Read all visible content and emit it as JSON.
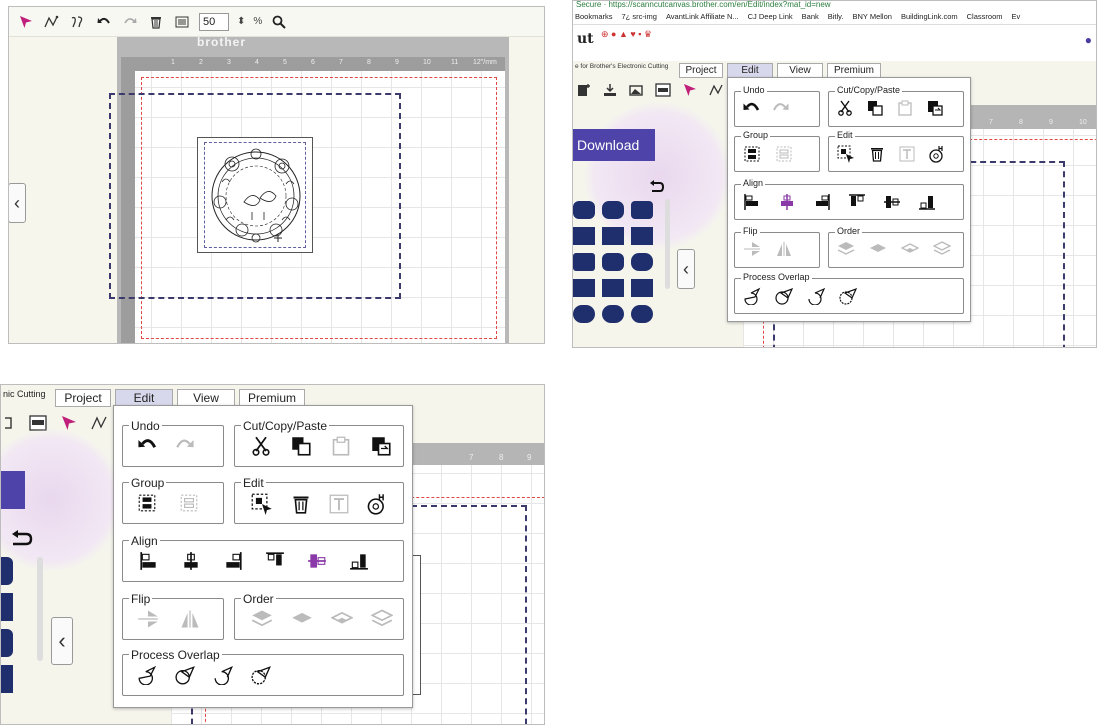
{
  "panel1": {
    "zoom_value": "50",
    "zoom_unit": "%",
    "mat_brand": "brother",
    "ruler_ticks": [
      "1",
      "2",
      "3",
      "4",
      "5",
      "6",
      "7",
      "8",
      "9",
      "10",
      "11",
      "12\"/mm"
    ]
  },
  "panel2": {
    "url": "Secure · https://scanncutcanvas.brother.com/en/Edit/index?mat_id=new",
    "bookmarks": [
      "Bookmarks",
      "7¿ src-img",
      "AvantLink Affiliate N...",
      "CJ Deep Link",
      "Bank",
      "Bitly.",
      "BNY Mellon",
      "BuildingLink.com",
      "Classroom",
      "Ev"
    ],
    "logo_text": "ut",
    "logo_sub": "e for Brother's Electronic Cutting",
    "menu": [
      "Project",
      "Edit",
      "View",
      "Premium"
    ],
    "download_label": "Download",
    "ruler_ticks": [
      "7",
      "8",
      "9",
      "10"
    ]
  },
  "panel3": {
    "logo_sub": "nic Cutting",
    "menu": [
      "Project",
      "Edit",
      "View",
      "Premium"
    ],
    "ruler_ticks": [
      "7",
      "8",
      "9"
    ]
  },
  "edit_menu": {
    "undo_title": "Undo",
    "cutcopypaste_title": "Cut/Copy/Paste",
    "group_title": "Group",
    "edit_title": "Edit",
    "align_title": "Align",
    "flip_title": "Flip",
    "order_title": "Order",
    "process_overlap_title": "Process Overlap"
  },
  "colors": {
    "accent_purple": "#4d43a8",
    "select_pink": "#c0207a",
    "shape_navy": "#1f2e6c",
    "cut_line_blue": "#3a3a6c",
    "margin_red": "#e04848"
  }
}
